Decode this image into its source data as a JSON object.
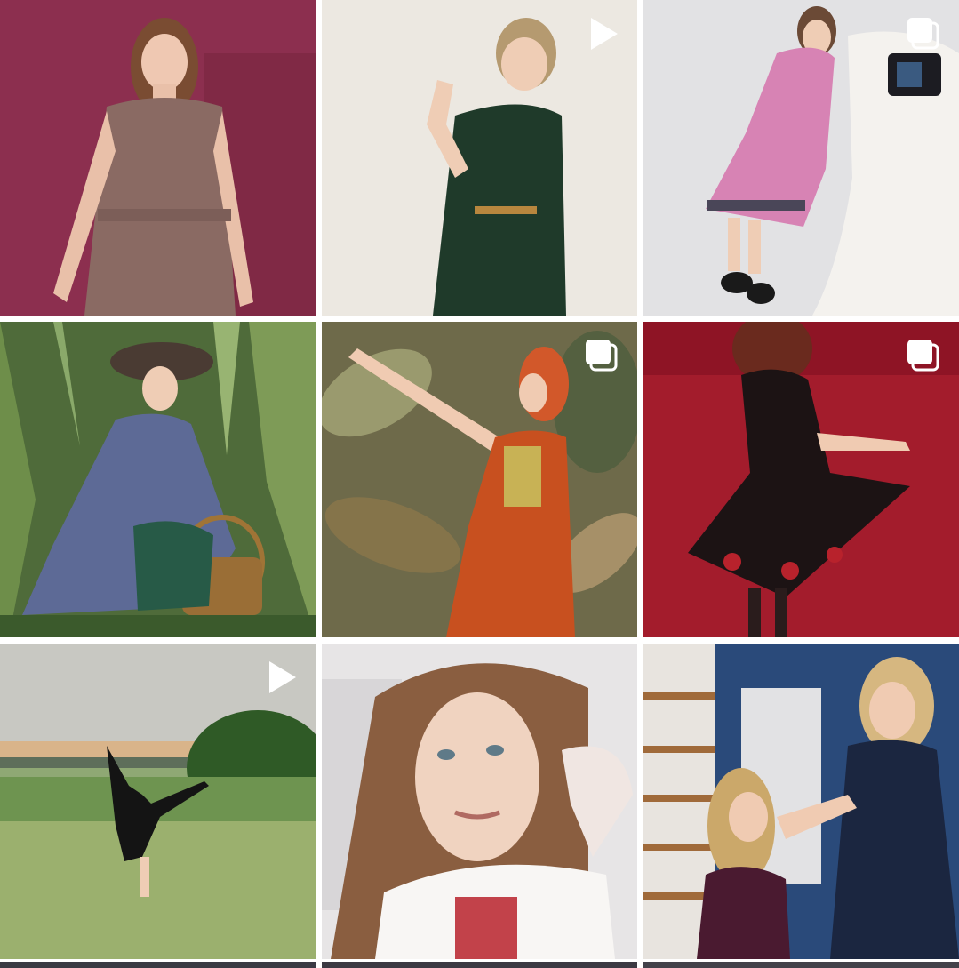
{
  "feed": {
    "posts": [
      {
        "id": "post-1",
        "type": "photo",
        "badge": "none",
        "bg": "#8c2f4f"
      },
      {
        "id": "post-2",
        "type": "video",
        "badge": "play-icon",
        "bg": "#ece8e1"
      },
      {
        "id": "post-3",
        "type": "carousel",
        "badge": "carousel-icon",
        "bg": "#e2e2e4"
      },
      {
        "id": "post-4",
        "type": "photo",
        "badge": "none",
        "bg": "#4f6b3a"
      },
      {
        "id": "post-5",
        "type": "carousel",
        "badge": "carousel-icon",
        "bg": "#6e6a4a"
      },
      {
        "id": "post-6",
        "type": "carousel",
        "badge": "carousel-icon",
        "bg": "#a31c2c"
      },
      {
        "id": "post-7",
        "type": "video",
        "badge": "play-icon",
        "bg": "#8fa874"
      },
      {
        "id": "post-8",
        "type": "photo",
        "badge": "none",
        "bg": "#e7e5e6"
      },
      {
        "id": "post-9",
        "type": "photo",
        "badge": "none",
        "bg": "#2a4a7a"
      }
    ]
  }
}
